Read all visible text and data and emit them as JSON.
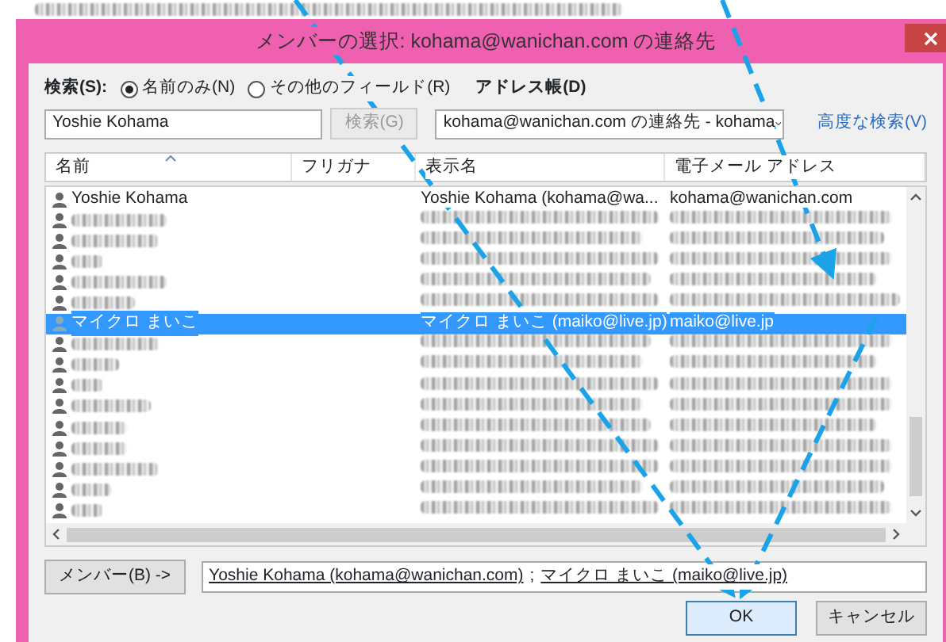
{
  "dialog": {
    "title": "メンバーの選択: kohama@wanichan.com の連絡先"
  },
  "search": {
    "label": "検索(S):",
    "options": [
      {
        "label": "名前のみ(N)",
        "selected": true
      },
      {
        "label": "その他のフィールド(R)",
        "selected": false
      }
    ],
    "value": "Yoshie Kohama",
    "button": {
      "label": "検索(G)",
      "disabled": true
    }
  },
  "address_book": {
    "label": "アドレス帳(D)",
    "value": "kohama@wanichan.com の連絡先 - kohama"
  },
  "advanced_search": "高度な検索(V)",
  "table": {
    "columns": [
      "名前",
      "フリガナ",
      "表示名",
      "電子メール アドレス"
    ],
    "rows": [
      {
        "kind": "contact",
        "name": "Yoshie Kohama",
        "display": "Yoshie Kohama (kohama@wa...",
        "email": "kohama@wanichan.com",
        "selected": false
      },
      {
        "kind": "obscured",
        "selected": false
      },
      {
        "kind": "obscured",
        "selected": false
      },
      {
        "kind": "obscured",
        "selected": false
      },
      {
        "kind": "obscured",
        "selected": false
      },
      {
        "kind": "obscured",
        "selected": false
      },
      {
        "kind": "contact",
        "name": "マイクロ まいこ",
        "display": "マイクロ まいこ (maiko@live.jp)",
        "email": "maiko@live.jp",
        "selected": true
      },
      {
        "kind": "obscured",
        "selected": false
      },
      {
        "kind": "obscured",
        "selected": false
      },
      {
        "kind": "obscured",
        "selected": false
      },
      {
        "kind": "obscured",
        "selected": false
      },
      {
        "kind": "obscured",
        "selected": false
      },
      {
        "kind": "obscured",
        "selected": false
      },
      {
        "kind": "obscured",
        "selected": false
      },
      {
        "kind": "obscured",
        "selected": false
      },
      {
        "kind": "obscured",
        "selected": false
      }
    ]
  },
  "members": {
    "button": "メンバー(B) ->",
    "entries": [
      "Yoshie Kohama (kohama@wanichan.com)",
      "マイクロ まいこ (maiko@live.jp)"
    ],
    "separator": ";"
  },
  "buttons": [
    {
      "label": "OK",
      "kind": "default"
    },
    {
      "label": "キャンセル",
      "kind": "normal"
    }
  ]
}
